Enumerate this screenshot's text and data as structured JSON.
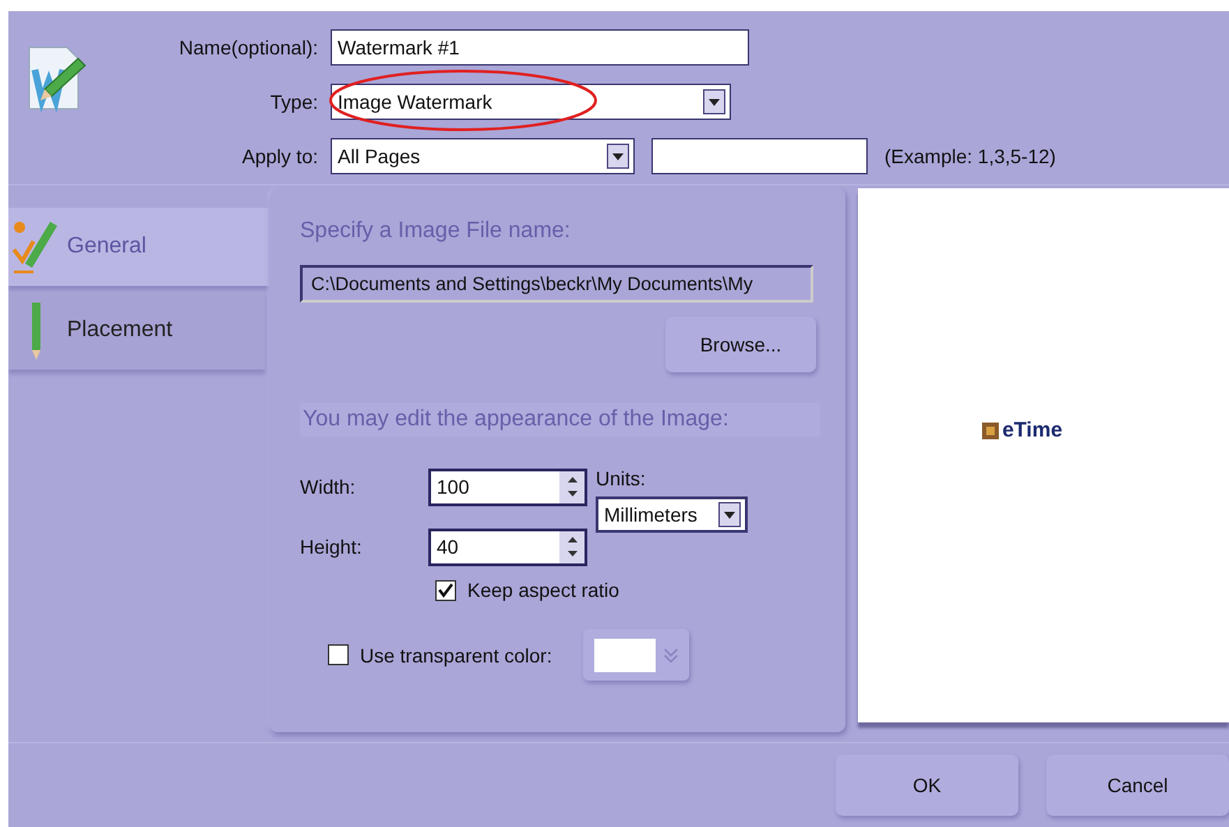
{
  "header": {
    "fields": [
      {
        "label": "Name(optional):",
        "kind": "text",
        "value": "Watermark #1"
      },
      {
        "label": "Type:",
        "kind": "dropdown",
        "value": "Image Watermark",
        "annotated": true
      },
      {
        "label": "Apply to:",
        "kind": "dropdown",
        "value": "All Pages",
        "hint": "(Example: 1,3,5-12)"
      }
    ]
  },
  "tabs": [
    {
      "label": "General",
      "selected": true
    },
    {
      "label": "Placement",
      "selected": false
    }
  ],
  "panel": {
    "file_heading": "Specify a Image File name:",
    "file_path": "C:\\Documents and Settings\\beckr\\My Documents\\My",
    "browse_button": "Browse...",
    "appearance_heading": "You may edit the appearance of the Image:",
    "width": {
      "label": "Width:",
      "value": "100"
    },
    "height": {
      "label": "Height:",
      "value": "40"
    },
    "units": {
      "label": "Units:",
      "value": "Millimeters"
    },
    "keep_aspect": {
      "label": "Keep aspect ratio",
      "checked": true
    },
    "transparent": {
      "label": "Use transparent color:",
      "checked": false
    }
  },
  "preview": {
    "logo_text": "eTime"
  },
  "buttons": [
    "OK",
    "Cancel"
  ]
}
